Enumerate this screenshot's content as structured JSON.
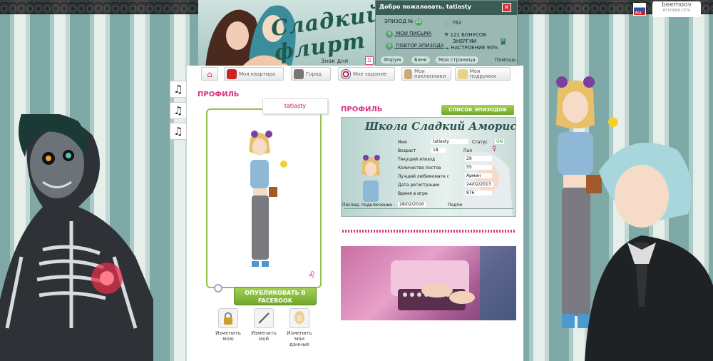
{
  "header": {
    "welcome": "Добро пожаловать, tatiasty",
    "episode_label": "ЭПИЗОД №",
    "episode_number": "29",
    "my_letters": "МОИ ПИСЬМА",
    "letters_count": "0",
    "replay_episode": "ПОВТОР ЭПИЗОДА",
    "replay_count": "0",
    "money": "762",
    "bonus": "121 БОНУСОВ",
    "energy": "ЭНЕРГИИ",
    "mood": "НАСТРОЕНИЕ 90%",
    "links": [
      "Форум",
      "Банк",
      "Моя страница"
    ],
    "help": "Помощь",
    "znak_dnya": "Знак дня",
    "logo": "Сладкий флирт",
    "lang": "RU",
    "network_brand": "beemoov",
    "network_label": "ИГРОВАЯ СЕТЬ"
  },
  "nav": {
    "items": [
      "Моя квартира",
      "Город",
      "Мое задание",
      "Мои поклонники",
      "Мои подружки"
    ]
  },
  "profile": {
    "title": "ПРОФИЛЬ",
    "username": "tatiasty",
    "publish_button": "ОПУБЛИКОВАТЬ В FACEBOOK",
    "actions": [
      "Изменить мою",
      "Изменить мой",
      "Изменить мои данные"
    ]
  },
  "profile_card": {
    "title": "ПРОФИЛЬ",
    "episodes_button": "СПИСОК ЭПИЗОДОВ",
    "school": "Школа Сладкий Аморис",
    "fields": [
      {
        "label": "Имя",
        "value": "tatiasty"
      },
      {
        "label": "Возраст",
        "value": "18"
      },
      {
        "label": "Текущий эпизод",
        "value": "29"
      },
      {
        "label": "Количество постов",
        "value": "55"
      },
      {
        "label": "Лучший любимомате с",
        "value": "Армин"
      },
      {
        "label": "Дата регистрации",
        "value": "24/02/2013"
      },
      {
        "label": "Время в игре",
        "value": "876"
      }
    ],
    "status_label": "Статус",
    "status_value": "ON",
    "gender_label": "Пол",
    "last_login_label": "Послед. подключение :",
    "last_login_value": "28/02/2016",
    "subscribers_label": "Подпи"
  },
  "colors": {
    "accent": "#d6337c",
    "green": "#7fb43a"
  }
}
